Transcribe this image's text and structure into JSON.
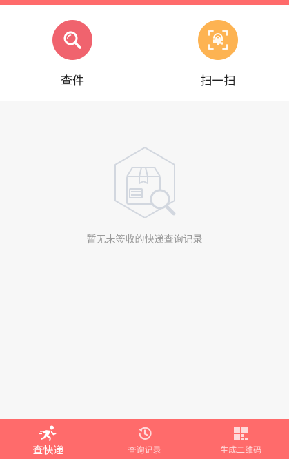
{
  "actions": {
    "search_label": "查件",
    "scan_label": "扫一扫"
  },
  "empty_state": {
    "message": "暂无未签收的快递查询记录"
  },
  "tabbar": {
    "tabs": [
      {
        "label": "查快递",
        "icon": "runner-icon",
        "active": true
      },
      {
        "label": "查询记录",
        "icon": "history-icon",
        "active": false
      },
      {
        "label": "生成二维码",
        "icon": "qrcode-icon",
        "active": false
      }
    ]
  },
  "colors": {
    "brand": "#ff6b6b",
    "search_circle": "#f0636e",
    "scan_circle": "#fdb352"
  }
}
